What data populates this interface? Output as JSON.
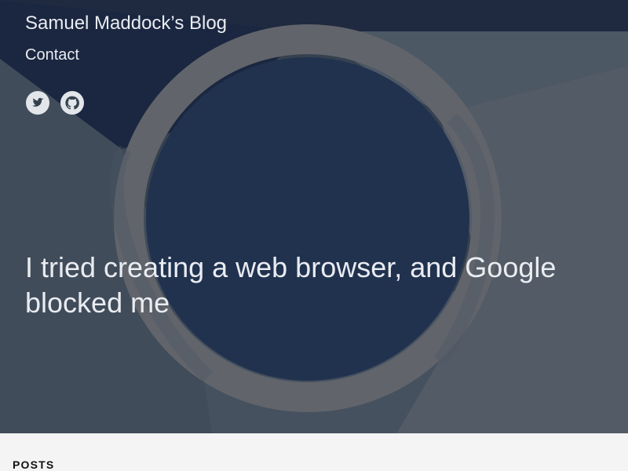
{
  "site": {
    "title": "Samuel Maddock’s Blog"
  },
  "nav": {
    "contact_label": "Contact"
  },
  "social": [
    {
      "icon": "twitter-icon"
    },
    {
      "icon": "github-icon"
    }
  ],
  "hero": {
    "post_title": "I tried creating a web browser, and Google blocked me"
  },
  "posts": {
    "section_label": "POSTS"
  },
  "colors": {
    "hero_text": "#e9ecf1",
    "hero_navy": "#1f2f4b",
    "hero_gray": "#5f6670",
    "page_background": "#f4f4f4"
  }
}
